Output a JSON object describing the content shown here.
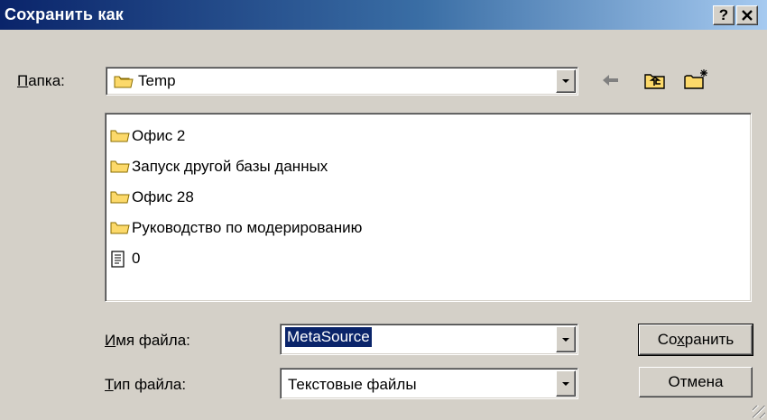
{
  "window": {
    "title": "Сохранить как",
    "help_label": "?",
    "close_label": "✕"
  },
  "location": {
    "label_access": "П",
    "label_rest": "апка:",
    "value": "Temp",
    "icon": "folder-icon"
  },
  "toolbar": {
    "back_icon": "back-arrow-icon",
    "up_icon": "up-folder-icon",
    "new_icon": "new-folder-icon"
  },
  "files": [
    {
      "name": "Офис 2",
      "icon": "folder-icon"
    },
    {
      "name": "Запуск другой базы данных",
      "icon": "folder-icon"
    },
    {
      "name": "Офис 28",
      "icon": "folder-icon"
    },
    {
      "name": "Руководство по модерированию",
      "icon": "folder-icon"
    },
    {
      "name": "0",
      "icon": "text-file-icon"
    }
  ],
  "filename": {
    "label_access": "И",
    "label_rest": "мя файла:",
    "value": "MetaSource"
  },
  "filetype": {
    "label_access": "Т",
    "label_rest": "ип файла:",
    "value": "Текстовые файлы"
  },
  "buttons": {
    "save_pre": "Со",
    "save_access": "х",
    "save_post": "ранить",
    "cancel": "Отмена"
  },
  "colors": {
    "title_start": "#0a246a",
    "title_end": "#a6caf0",
    "face": "#d4d0c8",
    "selection": "#0a246a"
  }
}
